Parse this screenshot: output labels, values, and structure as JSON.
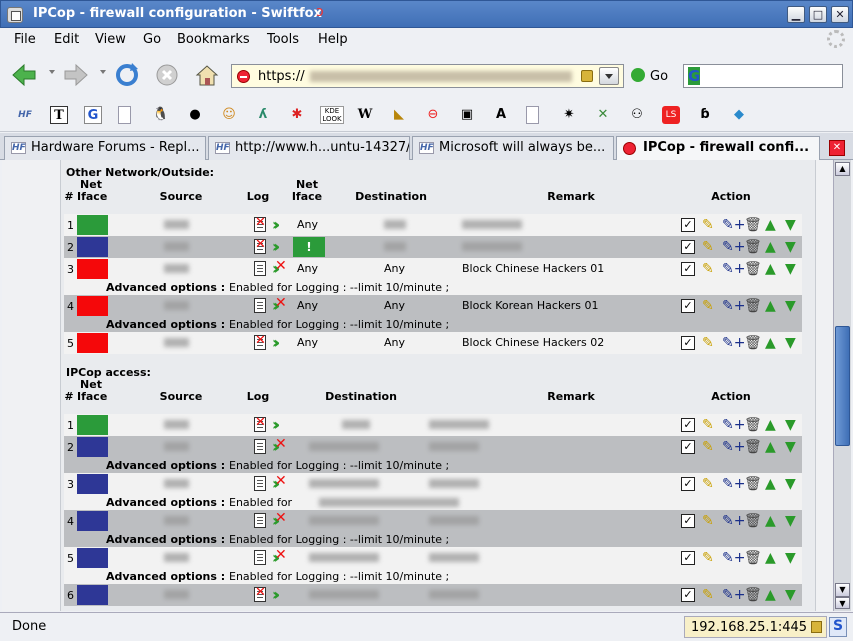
{
  "window": {
    "title": "IPCop - firewall configuration - Swiftfox"
  },
  "menu": [
    "File",
    "Edit",
    "View",
    "Go",
    "Bookmarks",
    "Tools",
    "Help"
  ],
  "nav": {
    "url": "https://",
    "go_label": "Go"
  },
  "tabs": [
    {
      "label": "Hardware Forums - Repl...",
      "icon": "HF"
    },
    {
      "label": "http://www.h...untu-14327/",
      "icon": "HF"
    },
    {
      "label": "Microsoft will always be...",
      "icon": "HF"
    },
    {
      "label": "IPCop - firewall confi...",
      "icon": "ipcop",
      "active": true
    }
  ],
  "bookmarks_toolbar": [
    "HF",
    "T",
    "G",
    "page",
    "tux",
    "grenade",
    "cat",
    "leaf",
    "bug",
    "KDE LOOK",
    "W",
    "hat",
    "stop",
    "robot",
    "AE",
    "page2",
    "spider",
    "x",
    "people",
    "LS",
    "flag",
    "parrot"
  ],
  "section1": {
    "title": "Other Network/Outside:",
    "headers": {
      "num": "#",
      "net_iface": "Net Iface",
      "source": "Source",
      "log": "Log",
      "net_iface2": "Net Iface",
      "destination": "Destination",
      "remark": "Remark",
      "action": "Action"
    },
    "rows": [
      {
        "num": "1",
        "iface_color": "#2b9b3a",
        "log": "off",
        "iface2": "Any",
        "dest_blurred": true,
        "remark_blurred": true
      },
      {
        "num": "2",
        "iface_color": "#2e3796",
        "log": "off",
        "iface2": "!",
        "dest_blurred": true,
        "remark_blurred": true
      },
      {
        "num": "3",
        "iface_color": "#f5080a",
        "log": "on",
        "iface2": "Any",
        "dest": "Any",
        "remark": "Block Chinese Hackers 01",
        "adv": "Enabled for Logging : --limit 10/minute ;"
      },
      {
        "num": "4",
        "iface_color": "#f5080a",
        "log": "on",
        "iface2": "Any",
        "dest": "Any",
        "remark": "Block Korean Hackers 01",
        "adv": "Enabled for Logging : --limit 10/minute ;"
      },
      {
        "num": "5",
        "iface_color": "#f5080a",
        "log": "off",
        "iface2": "Any",
        "dest": "Any",
        "remark": "Block Chinese Hackers 02"
      }
    ]
  },
  "section2": {
    "title": "IPCop access:",
    "headers": {
      "num": "#",
      "net_iface": "Net Iface",
      "source": "Source",
      "log": "Log",
      "destination": "Destination",
      "remark": "Remark",
      "action": "Action"
    },
    "adv_label": "Advanced options :",
    "rows": [
      {
        "num": "1",
        "iface_color": "#2b9b3a",
        "log": "off"
      },
      {
        "num": "2",
        "iface_color": "#2e3796",
        "log": "on",
        "adv": "Enabled for Logging : --limit 10/minute ;"
      },
      {
        "num": "3",
        "iface_color": "#2e3796",
        "log": "on",
        "adv": "Enabled for"
      },
      {
        "num": "4",
        "iface_color": "#2e3796",
        "log": "on",
        "adv": "Enabled for Logging : --limit 10/minute ;"
      },
      {
        "num": "5",
        "iface_color": "#2e3796",
        "log": "on",
        "adv": "Enabled for Logging : --limit 10/minute ;"
      },
      {
        "num": "6",
        "iface_color": "#2e3796",
        "log": "off"
      }
    ]
  },
  "status": {
    "text": "Done",
    "host": "192.168.25.1:445"
  }
}
